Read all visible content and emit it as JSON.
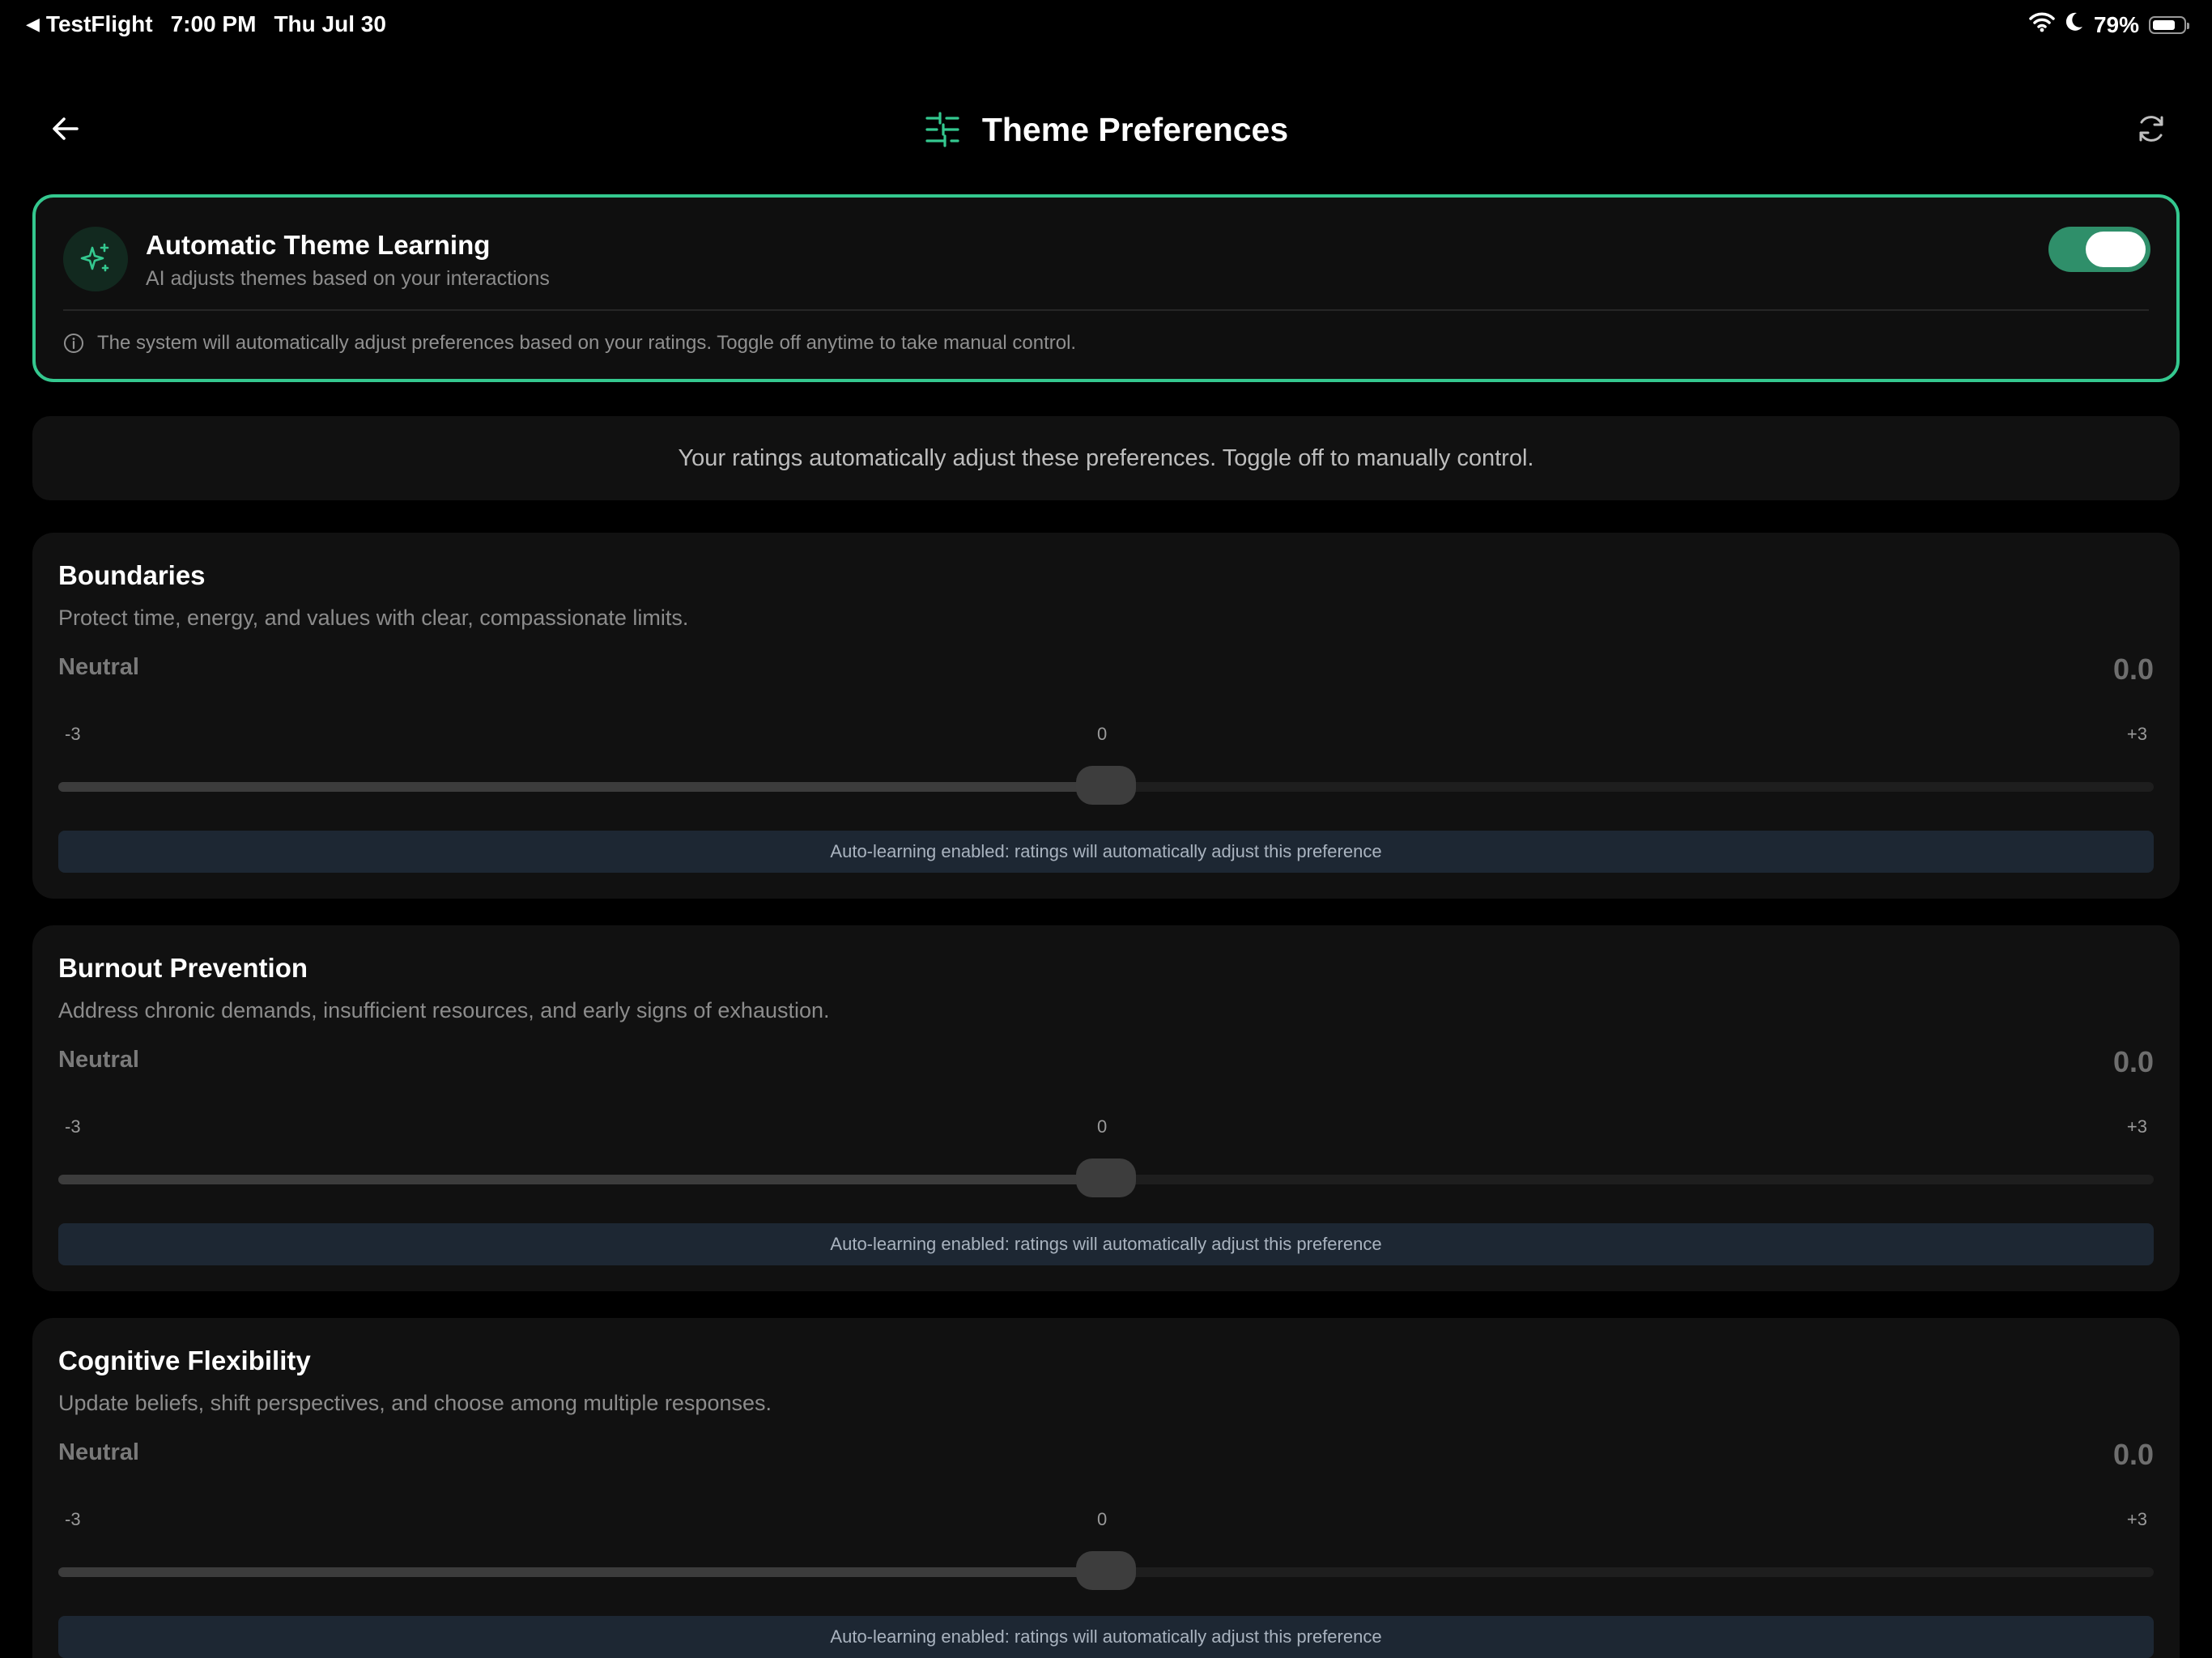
{
  "status_bar": {
    "back_app": "TestFlight",
    "time": "7:00 PM",
    "date": "Thu Jul 30",
    "battery_percent": "79%",
    "battery_level": 0.79
  },
  "header": {
    "title": "Theme Preferences"
  },
  "auto_learning": {
    "title": "Automatic Theme Learning",
    "subtitle": "AI adjusts themes based on your interactions",
    "enabled": true,
    "info": "The system will automatically adjust preferences based on your ratings. Toggle off anytime to take manual control."
  },
  "notice": "Your ratings automatically adjust these preferences. Toggle off to manually control.",
  "preferences": [
    {
      "title": "Boundaries",
      "description": "Protect time, energy, and values with clear, compassionate limits.",
      "state": "Neutral",
      "value_label": "0.0",
      "value": 0,
      "min_label": "-3",
      "mid_label": "0",
      "max_label": "+3",
      "banner": "Auto-learning enabled: ratings will automatically adjust this preference"
    },
    {
      "title": "Burnout Prevention",
      "description": "Address chronic demands, insufficient resources, and early signs of exhaustion.",
      "state": "Neutral",
      "value_label": "0.0",
      "value": 0,
      "min_label": "-3",
      "mid_label": "0",
      "max_label": "+3",
      "banner": "Auto-learning enabled: ratings will automatically adjust this preference"
    },
    {
      "title": "Cognitive Flexibility",
      "description": "Update beliefs, shift perspectives, and choose among multiple responses.",
      "state": "Neutral",
      "value_label": "0.0",
      "value": 0,
      "min_label": "-3",
      "mid_label": "0",
      "max_label": "+3",
      "banner": "Auto-learning enabled: ratings will automatically adjust this preference"
    }
  ],
  "slider_range": [
    -3,
    3
  ],
  "colors": {
    "accent": "#34c88f",
    "toggle_on": "#2f8f6a",
    "banner_bg": "#1d2733"
  },
  "icons": {
    "back": "arrow-left-icon",
    "title": "sliders-icon",
    "refresh": "refresh-icon",
    "auto": "sparkles-icon",
    "info": "info-icon"
  }
}
